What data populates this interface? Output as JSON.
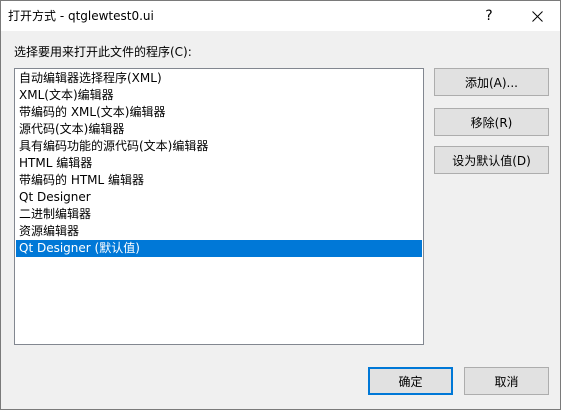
{
  "window": {
    "title": "打开方式 - qtglewtest0.ui",
    "help_glyph": "?",
    "close_icon": "close-icon"
  },
  "prompt": "选择要用来打开此文件的程序(C):",
  "programs": [
    "自动编辑器选择程序(XML)",
    "XML(文本)编辑器",
    "带编码的 XML(文本)编辑器",
    "源代码(文本)编辑器",
    "具有编码功能的源代码(文本)编辑器",
    "HTML 编辑器",
    "带编码的 HTML 编辑器",
    "Qt Designer",
    "二进制编辑器",
    "资源编辑器",
    "Qt Designer (默认值)"
  ],
  "selected_program": "Qt Designer (默认值)",
  "buttons": {
    "add": "添加(A)...",
    "remove": "移除(R)",
    "set_default": "设为默认值(D)",
    "ok": "确定",
    "cancel": "取消"
  },
  "colors": {
    "selection": "#0078d7",
    "window_bg": "#f0f0f0"
  }
}
